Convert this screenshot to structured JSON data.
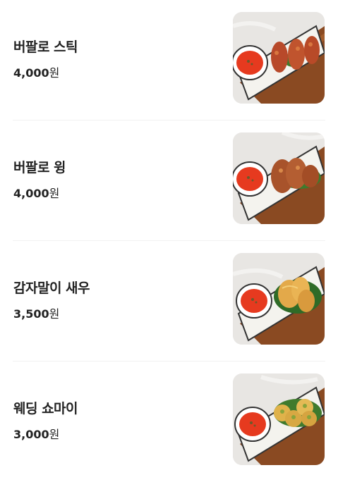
{
  "menu": {
    "items": [
      {
        "name": "버팔로 스틱",
        "price": "4,000",
        "unit": "원",
        "food": "buffalo-stick-photo"
      },
      {
        "name": "버팔로 윙",
        "price": "4,000",
        "unit": "원",
        "food": "buffalo-wing-photo"
      },
      {
        "name": "감자말이 새우",
        "price": "3,500",
        "unit": "원",
        "food": "potato-shrimp-photo"
      },
      {
        "name": "웨딩 쇼마이",
        "price": "3,000",
        "unit": "원",
        "food": "wedding-shumai-photo"
      }
    ]
  }
}
